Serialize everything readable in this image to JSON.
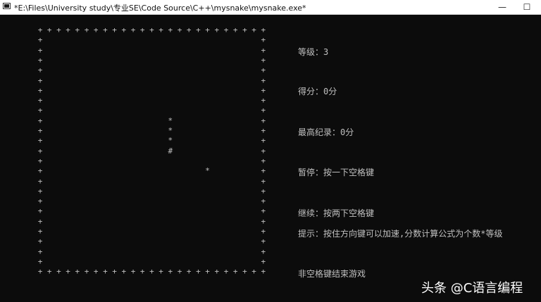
{
  "window": {
    "title": "*E:\\Files\\University study\\专业SE\\Code Source\\C++\\mysnake\\mysnake.exe*",
    "minimize_glyph": "—",
    "maximize_glyph": "☐"
  },
  "board": {
    "border_char": "+",
    "snake_body_char": "*",
    "snake_head_char": "#",
    "food_char": "*"
  },
  "info": {
    "level": "等级：3",
    "score": "得分：0分",
    "high_score": "最高纪录：0分",
    "pause": "暂停：按一下空格键",
    "resume": "继续：按两下空格键",
    "tip": "提示：按住方向键可以加速,分数计算公式为个数*等级",
    "exit": "非空格键结束游戏"
  },
  "watermark": "头条 @C语言编程"
}
